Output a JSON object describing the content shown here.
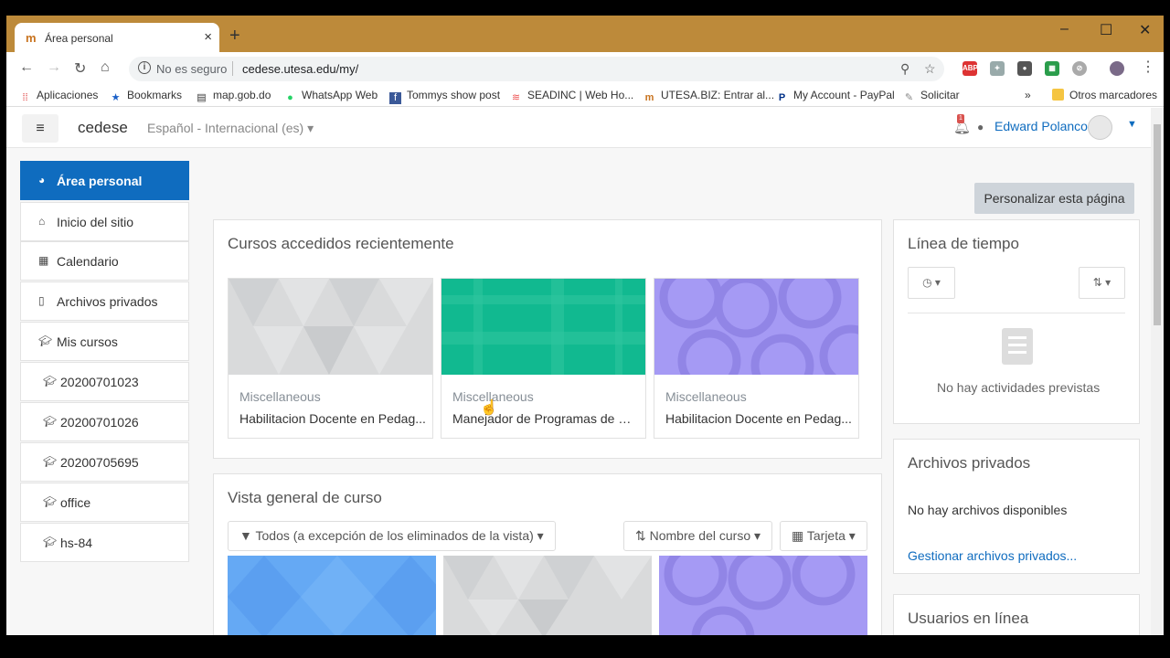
{
  "browser": {
    "tab_title": "Área personal",
    "tab_close": "×",
    "new_tab": "+",
    "window_min": "–",
    "window_max": "☐",
    "window_close": "✕",
    "security_label": "No es seguro",
    "url": "cedese.utesa.edu/my/",
    "bookmarks": [
      {
        "label": "Aplicaciones"
      },
      {
        "label": "Bookmarks"
      },
      {
        "label": "map.gob.do"
      },
      {
        "label": "WhatsApp Web"
      },
      {
        "label": "Tommys show post"
      },
      {
        "label": "SEADINC | Web Ho..."
      },
      {
        "label": "UTESA.BIZ: Entrar al..."
      },
      {
        "label": "My Account - PayPal"
      },
      {
        "label": "Solicitar"
      }
    ],
    "bookmarks_more": "»",
    "other_bookmarks": "Otros marcadores",
    "extensions": [
      "ABP"
    ]
  },
  "navbar": {
    "brand": "cedese",
    "language": "Español - Internacional (es)",
    "notification_count": "1",
    "user_name": "Edward Polanco"
  },
  "sidebar": {
    "items": [
      {
        "label": "Área personal"
      },
      {
        "label": "Inicio del sitio"
      },
      {
        "label": "Calendario"
      },
      {
        "label": "Archivos privados"
      },
      {
        "label": "Mis cursos"
      },
      {
        "label": "20200701023"
      },
      {
        "label": "20200701026"
      },
      {
        "label": "20200705695"
      },
      {
        "label": "office"
      },
      {
        "label": "hs-84"
      }
    ]
  },
  "main": {
    "customize_button": "Personalizar esta página",
    "recent": {
      "title": "Cursos accedidos recientemente",
      "courses": [
        {
          "category": "Miscellaneous",
          "name": "Habilitacion Docente en Pedag..."
        },
        {
          "category": "Miscellaneous",
          "name": "Manejador de Programas de Of..."
        },
        {
          "category": "Miscellaneous",
          "name": "Habilitacion Docente en Pedag..."
        }
      ]
    },
    "overview": {
      "title": "Vista general de curso",
      "filter": "Todos (a excepción de los eliminados de la vista)",
      "sort": "Nombre del curso",
      "view": "Tarjeta"
    }
  },
  "blocks": {
    "timeline": {
      "title": "Línea de tiempo",
      "empty": "No hay actividades previstas"
    },
    "private_files": {
      "title": "Archivos privados",
      "empty": "No hay archivos disponibles",
      "manage_link": "Gestionar archivos privados..."
    },
    "online_users": {
      "title": "Usuarios en línea"
    }
  },
  "colors": {
    "titlebar": "#bd8a3a",
    "primary": "#0f6cbf"
  }
}
